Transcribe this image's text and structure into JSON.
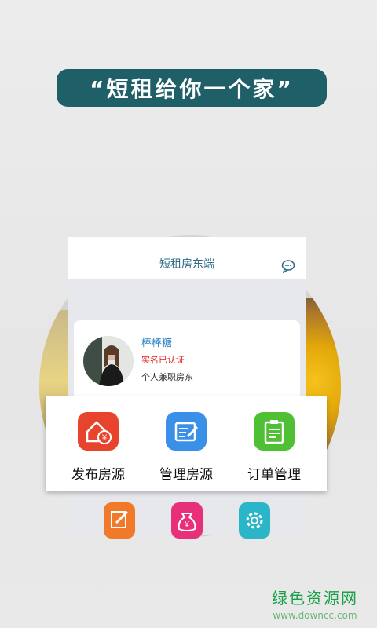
{
  "slogan": "“短租给你一个家”",
  "app": {
    "title": "短租房东端",
    "icons": {
      "chat": "chat-bubble-icon"
    }
  },
  "profile": {
    "name": "棒棒糖",
    "verified": "实名已认证",
    "role": "个人兼职房东"
  },
  "actions": [
    {
      "label": "发布房源",
      "icon": "house-yen-icon",
      "color": "#e8432c"
    },
    {
      "label": "管理房源",
      "icon": "edit-list-icon",
      "color": "#3a8fe8"
    },
    {
      "label": "订单管理",
      "icon": "clipboard-icon",
      "color": "#4fbf34"
    }
  ],
  "more_actions": [
    {
      "icon": "pencil-icon",
      "color": "#f07a2a"
    },
    {
      "icon": "money-bag-icon",
      "color": "#e8307a"
    },
    {
      "icon": "gear-icon",
      "color": "#2ab6c8"
    }
  ],
  "watermark": {
    "title": "绿色资源网",
    "url": "www.downcc.com"
  },
  "colors": {
    "slogan_bg": "#1f5f68",
    "nav_title": "#2d6a86",
    "name": "#2f84c4",
    "verified": "#e02020"
  }
}
